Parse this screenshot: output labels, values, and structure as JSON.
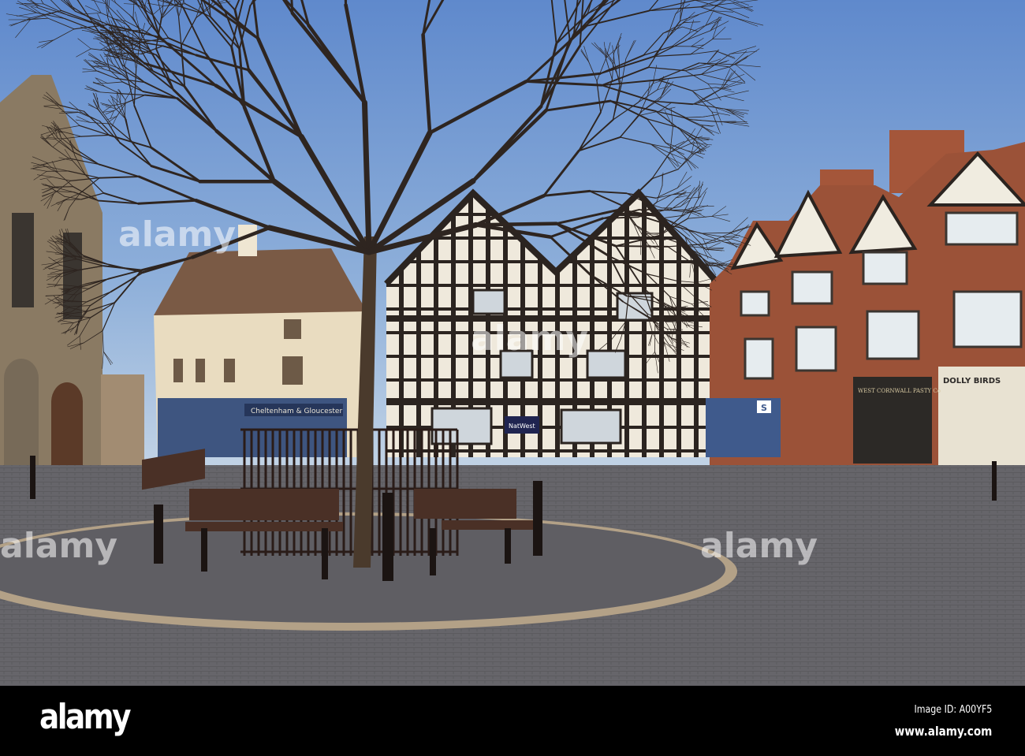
{
  "watermark": {
    "text": "alamy"
  },
  "footer": {
    "logo": "alamy",
    "image_id": "Image ID: A00YF5",
    "url": "www.alamy.com"
  },
  "signs": {
    "bank_left": "Cheltenham & Gloucester",
    "bank_center": "NatWest",
    "shop_pasty": "WEST CORNWALL PASTY Co",
    "shop_dolly": "DOLLY BIRDS",
    "shop_s": "S"
  },
  "colors": {
    "sky_top": "#5d86c8",
    "sky_bottom": "#b9cde4",
    "pavement": "#6b6a6e",
    "timber": "#2b2420",
    "brick": "#8c4a33"
  }
}
